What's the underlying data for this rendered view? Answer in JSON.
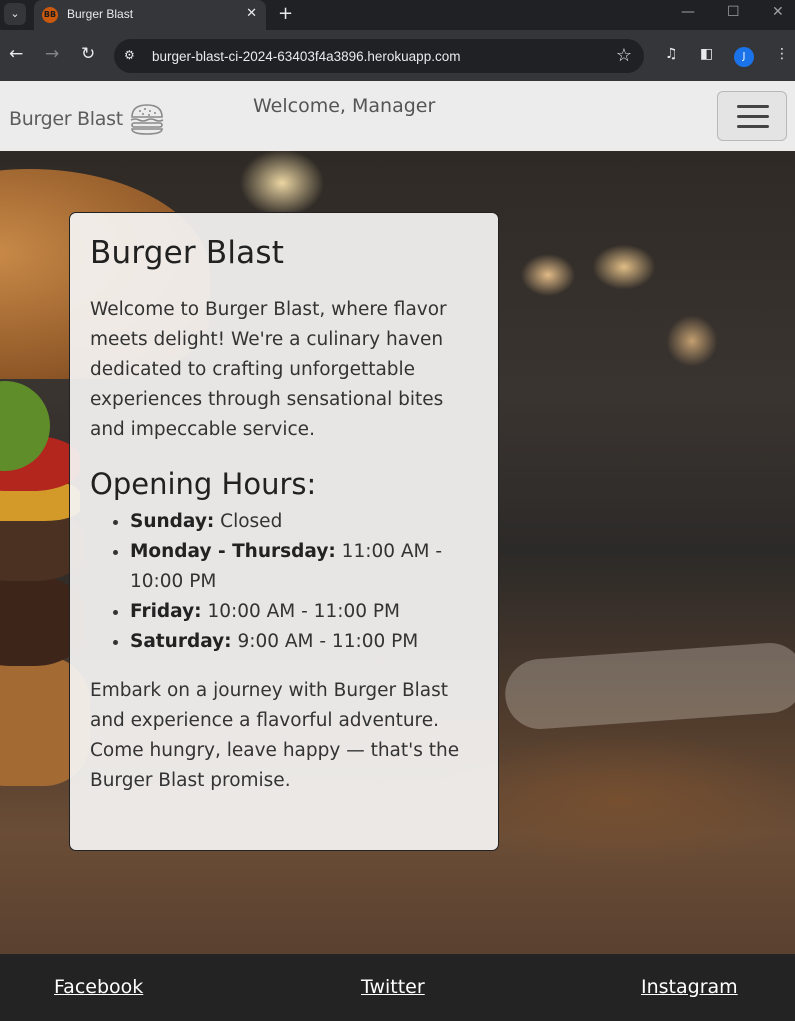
{
  "browser": {
    "tab_title": "Burger Blast",
    "favicon_text": "BB",
    "url": "burger-blast-ci-2024-63403f4a3896.herokuapp.com",
    "profile_initial": "J"
  },
  "header": {
    "logo_text": "Burger Blast",
    "welcome": "Welcome, Manager"
  },
  "card": {
    "title": "Burger Blast",
    "intro": "Welcome to Burger Blast, where flavor meets delight! We're a culinary haven dedicated to crafting unforgettable experiences through sensational bites and impeccable service.",
    "hours_title": "Opening Hours:",
    "hours": [
      {
        "day": "Sunday:",
        "time": "Closed"
      },
      {
        "day": "Monday - Thursday:",
        "time": "11:00 AM - 10:00 PM"
      },
      {
        "day": "Friday:",
        "time": "10:00 AM - 11:00 PM"
      },
      {
        "day": "Saturday:",
        "time": "9:00 AM - 11:00 PM"
      }
    ],
    "outro": "Embark on a journey with Burger Blast and experience a flavorful adventure. Come hungry, leave happy — that's the Burger Blast promise."
  },
  "footer": {
    "links": [
      "Facebook",
      "Twitter",
      "Instagram"
    ]
  },
  "colors": {
    "header_bg": "#ececec",
    "footer_bg": "#232323",
    "card_bg": "#f5f4f3"
  }
}
